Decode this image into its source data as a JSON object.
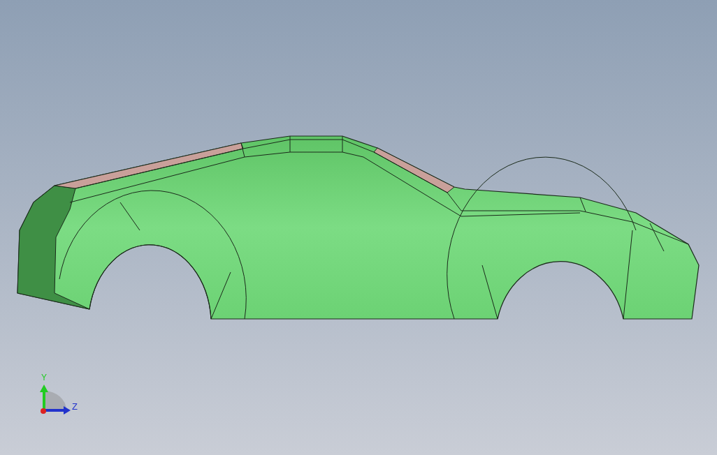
{
  "viewport": {
    "axes": [
      {
        "label": "Y"
      },
      {
        "label": "Z"
      }
    ]
  }
}
